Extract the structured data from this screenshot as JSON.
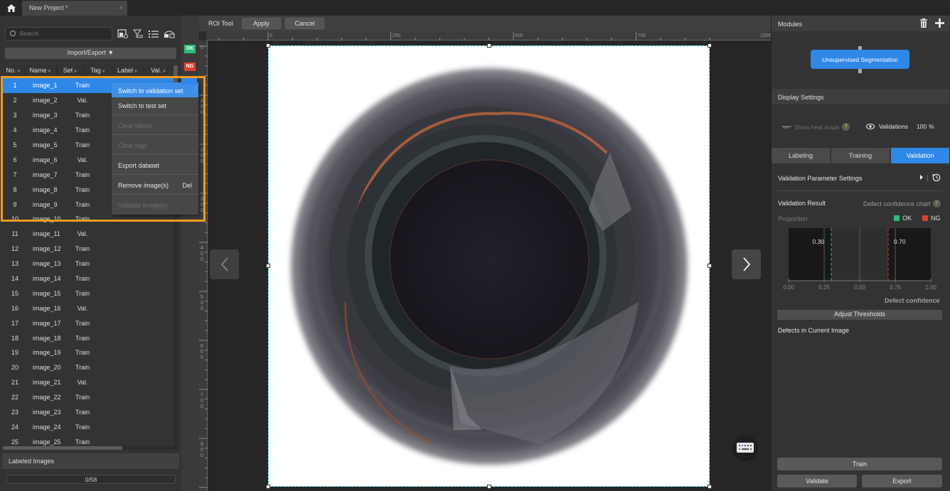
{
  "window": {
    "home_icon": "home-icon",
    "project_tab": "New Project *",
    "close_tab": "×"
  },
  "left_panel": {
    "search_placeholder": "Search",
    "tool_icons": [
      "image-settings-icon",
      "filter-icon",
      "list-icon",
      "roi-icon"
    ],
    "import_export": "Import/Export ▼",
    "columns": [
      "No.",
      "Name",
      "Set",
      "Tag",
      "Label",
      "Val."
    ],
    "rows": [
      {
        "no": "1",
        "name": "image_1",
        "set": "Train"
      },
      {
        "no": "2",
        "name": "image_2",
        "set": "Val."
      },
      {
        "no": "3",
        "name": "image_3",
        "set": "Train"
      },
      {
        "no": "4",
        "name": "image_4",
        "set": "Train"
      },
      {
        "no": "5",
        "name": "image_5",
        "set": "Train"
      },
      {
        "no": "6",
        "name": "image_6",
        "set": "Val."
      },
      {
        "no": "7",
        "name": "image_7",
        "set": "Train"
      },
      {
        "no": "8",
        "name": "image_8",
        "set": "Train"
      },
      {
        "no": "9",
        "name": "image_9",
        "set": "Train"
      },
      {
        "no": "10",
        "name": "image_10",
        "set": "Train"
      },
      {
        "no": "11",
        "name": "image_11",
        "set": "Val."
      },
      {
        "no": "12",
        "name": "image_12",
        "set": "Train"
      },
      {
        "no": "13",
        "name": "image_13",
        "set": "Train"
      },
      {
        "no": "14",
        "name": "image_14",
        "set": "Train"
      },
      {
        "no": "15",
        "name": "image_15",
        "set": "Train"
      },
      {
        "no": "16",
        "name": "image_16",
        "set": "Val."
      },
      {
        "no": "17",
        "name": "image_17",
        "set": "Train"
      },
      {
        "no": "18",
        "name": "image_18",
        "set": "Train"
      },
      {
        "no": "19",
        "name": "image_19",
        "set": "Train"
      },
      {
        "no": "20",
        "name": "image_20",
        "set": "Train"
      },
      {
        "no": "21",
        "name": "image_21",
        "set": "Val."
      },
      {
        "no": "22",
        "name": "image_22",
        "set": "Train"
      },
      {
        "no": "23",
        "name": "image_23",
        "set": "Train"
      },
      {
        "no": "24",
        "name": "image_24",
        "set": "Train"
      },
      {
        "no": "25",
        "name": "image_25",
        "set": "Train"
      }
    ],
    "selected_row": 1,
    "labeled_images_title": "Labeled Images",
    "labeled_progress": "0/58",
    "labeled_fraction": 0
  },
  "flags": {
    "ok": "OK",
    "ng": "NG"
  },
  "context_menu": {
    "more": "····",
    "items": [
      {
        "label": "Switch to validation set",
        "enabled": true,
        "highlighted": true
      },
      {
        "label": "Switch to test set",
        "enabled": true
      },
      {
        "label": "Clear labels",
        "enabled": false
      },
      {
        "label": "Clear tags",
        "enabled": false
      },
      {
        "label": "Export dataset",
        "enabled": true
      },
      {
        "label": "Remove image(s)",
        "enabled": true,
        "shortcut": "Del"
      },
      {
        "label": "Validate image(s)",
        "enabled": false
      }
    ]
  },
  "canvas": {
    "toolbar": {
      "title": "ROI Tool",
      "apply": "Apply",
      "cancel": "Cancel"
    },
    "h_ruler_labels": [
      "0",
      "250",
      "500",
      "750",
      "1000"
    ],
    "v_ruler_labels": [
      "0",
      "100",
      "200",
      "300",
      "400",
      "500",
      "600",
      "700",
      "800"
    ],
    "prev_icon": "chevron-left-icon",
    "next_icon": "chevron-right-icon",
    "keyboard_icon": "keyboard-icon"
  },
  "right_panel": {
    "modules_title": "Modules",
    "module_name": "Unsupervised Segmentation",
    "display_settings_title": "Display Settings",
    "show_heat_maps": "Show heat maps",
    "validations_label": "Validations",
    "validations_value": "100",
    "validations_unit": "%",
    "tabs": [
      "Labeling",
      "Training",
      "Validation"
    ],
    "active_tab": "Validation",
    "validation_param_settings": "Validation Parameter Settings",
    "validation_result": "Validation Result",
    "defect_confidence_chart": "Defect confidence chart",
    "proportion": "Proportion",
    "legend_ok": "OK",
    "legend_ng": "NG",
    "defect_confidence": "Defect confidence",
    "adjust_thresholds": "Adjust Thresholds",
    "defects_in_current_image": "Defects in Current Image",
    "train": "Train",
    "validate": "Validate",
    "export": "Export",
    "colors": {
      "accent": "#2f87e6",
      "ok": "#2ebd7a",
      "ng": "#d9432f",
      "highlight_frame": "#f39a1e"
    }
  },
  "chart_data": {
    "type": "bar",
    "title": "Defect confidence chart",
    "xlabel": "Defect confidence",
    "ylabel": "Proportion",
    "x_ticks": [
      "0.00",
      "0.25",
      "0.50",
      "0.75",
      "1.00"
    ],
    "xlim": [
      0,
      1
    ],
    "thresholds": [
      {
        "name": "OK",
        "value": 0.3,
        "label": "0.30",
        "color": "#2ebd7a"
      },
      {
        "name": "NG",
        "value": 0.7,
        "label": "0.70",
        "color": "#d9432f"
      }
    ],
    "series": [],
    "legend": "top-right",
    "grid": true
  }
}
